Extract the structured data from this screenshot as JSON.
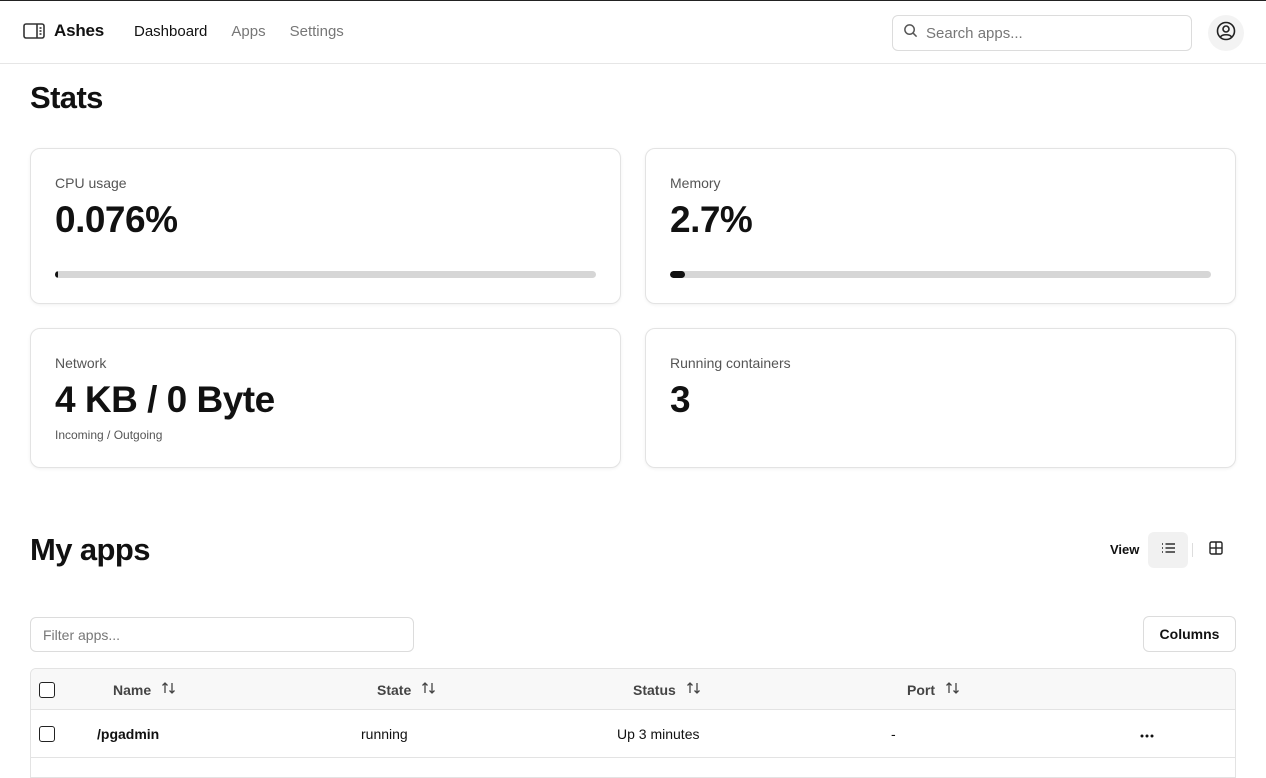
{
  "app": {
    "name": "Ashes"
  },
  "nav": {
    "dashboard": "Dashboard",
    "apps": "Apps",
    "settings": "Settings"
  },
  "search": {
    "placeholder": "Search apps..."
  },
  "stats": {
    "title": "Stats",
    "cpu": {
      "label": "CPU usage",
      "value": "0.076%",
      "percent": 0.076
    },
    "memory": {
      "label": "Memory",
      "value": "2.7%",
      "percent": 2.7
    },
    "network": {
      "label": "Network",
      "value": "4 KB / 0 Byte",
      "sub": "Incoming / Outgoing"
    },
    "containers": {
      "label": "Running containers",
      "value": "3"
    }
  },
  "apps": {
    "title": "My apps",
    "view_label": "View",
    "filter_placeholder": "Filter apps...",
    "columns_button": "Columns",
    "headers": {
      "name": "Name",
      "state": "State",
      "status": "Status",
      "port": "Port"
    },
    "rows": [
      {
        "name": "/pgadmin",
        "state": "running",
        "status": "Up 3 minutes",
        "port": "-"
      }
    ]
  },
  "icons": {
    "logo": "server-icon",
    "search": "search-icon",
    "user": "user-circle-icon",
    "list": "list-icon",
    "grid": "grid-icon",
    "sort": "sort-arrows-icon",
    "more": "more-horizontal-icon"
  }
}
